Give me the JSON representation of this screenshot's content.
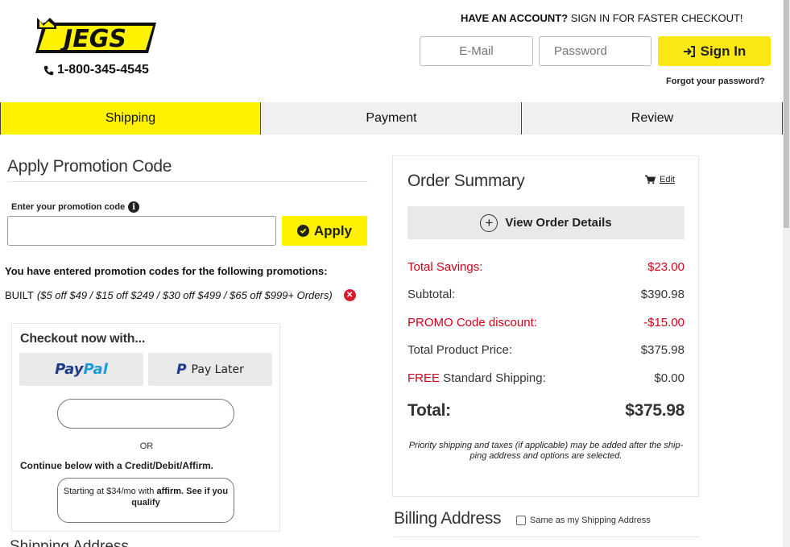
{
  "header": {
    "logo_text": "JEGS",
    "phone": "1-800-345-4545",
    "account_prompt_bold": "HAVE AN ACCOUNT?",
    "account_prompt_rest": " SIGN IN FOR FASTER CHECKOUT!",
    "email_placeholder": "E-Mail",
    "password_placeholder": "Password",
    "signin_label": "Sign In",
    "forgot_label": "Forgot your password?"
  },
  "steps": [
    {
      "label": "Shipping",
      "active": true
    },
    {
      "label": "Payment",
      "active": false
    },
    {
      "label": "Review",
      "active": false
    }
  ],
  "promo": {
    "title": "Apply Promotion Code",
    "input_label": "Enter your promotion code",
    "input_value": "",
    "apply_label": "Apply",
    "entered_text": "You have entered promotion codes for the following promotions:",
    "code": "BUILT",
    "code_details": "($5 off $49 / $15 off $249 / $30 off $499 / $65 off $999+ Orders)"
  },
  "checkout": {
    "title": "Checkout now with...",
    "paypal_a": "Pay",
    "paypal_b": "Pal",
    "paylater_label": "Pay Later",
    "or_label": "OR",
    "continue_label": "Continue below with a Credit/Debit/Affirm.",
    "affirm_prefix": "Starting at $34/mo with ",
    "affirm_brand": "affirm",
    "affirm_suffix": ". See if you qualify"
  },
  "shipping_address_title": "Shipping Address",
  "summary": {
    "title": "Order Summary",
    "edit_label": "Edit",
    "view_details_label": "View Order Details",
    "total_savings_label": "Total Savings:",
    "total_savings_value": "$23.00",
    "subtotal_label": "Subtotal:",
    "subtotal_value": "$390.98",
    "promo_discount_label": "PROMO Code discount:",
    "promo_discount_value": "-$15.00",
    "product_price_label": "Total Product Price:",
    "product_price_value": "$375.98",
    "shipping_free_word": "FREE",
    "shipping_label": " Standard Shipping:",
    "shipping_value": "$0.00",
    "total_label": "Total:",
    "total_value": "$375.98",
    "note": "Priority shipping and taxes (if applicable) may be added after the ship-ping address and options are selected."
  },
  "billing": {
    "title": "Billing Address",
    "same_label": "Same as my Shipping Address",
    "same_checked": false
  },
  "colors": {
    "brand_yellow": "#fef200",
    "promo_red": "#d0021b",
    "paypal_dark": "#1b3b8c",
    "paypal_light": "#1d9bd7"
  }
}
